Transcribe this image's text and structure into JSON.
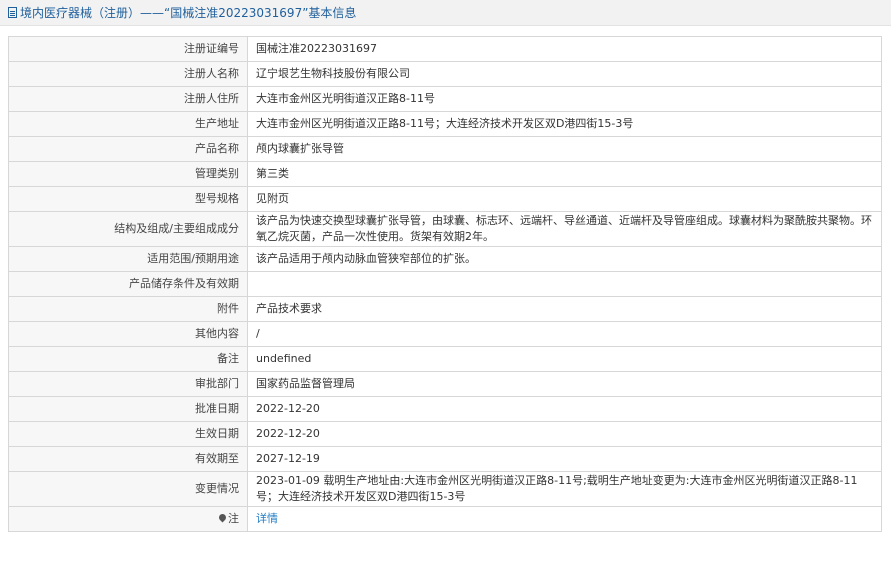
{
  "header": {
    "title": "境内医疗器械（注册）——“国械注准20223031697”基本信息"
  },
  "rows": [
    {
      "label": "注册证编号",
      "value": "国械注准20223031697"
    },
    {
      "label": "注册人名称",
      "value": "辽宁垠艺生物科技股份有限公司"
    },
    {
      "label": "注册人住所",
      "value": "大连市金州区光明街道汉正路8-11号"
    },
    {
      "label": "生产地址",
      "value": "大连市金州区光明街道汉正路8-11号；大连经济技术开发区双D港四街15-3号"
    },
    {
      "label": "产品名称",
      "value": "颅内球囊扩张导管"
    },
    {
      "label": "管理类别",
      "value": "第三类"
    },
    {
      "label": "型号规格",
      "value": "见附页"
    },
    {
      "label": "结构及组成/主要组成成分",
      "value": "该产品为快速交换型球囊扩张导管，由球囊、标志环、远端杆、导丝通道、近端杆及导管座组成。球囊材料为聚酰胺共聚物。环氧乙烷灭菌，产品一次性使用。货架有效期2年。"
    },
    {
      "label": "适用范围/预期用途",
      "value": "该产品适用于颅内动脉血管狭窄部位的扩张。"
    },
    {
      "label": "产品储存条件及有效期",
      "value": ""
    },
    {
      "label": "附件",
      "value": "产品技术要求"
    },
    {
      "label": "其他内容",
      "value": "/"
    },
    {
      "label": "备注",
      "value": "undefined"
    },
    {
      "label": "审批部门",
      "value": "国家药品监督管理局"
    },
    {
      "label": "批准日期",
      "value": "2022-12-20"
    },
    {
      "label": "生效日期",
      "value": "2022-12-20"
    },
    {
      "label": "有效期至",
      "value": "2027-12-19"
    },
    {
      "label": "变更情况",
      "value": "2023-01-09 载明生产地址由:大连市金州区光明街道汉正路8-11号;载明生产地址变更为:大连市金州区光明街道汉正路8-11号；大连经济技术开发区双D港四街15-3号"
    }
  ],
  "note": {
    "label": "注",
    "icon": "pin-icon",
    "link_text": "详情"
  }
}
